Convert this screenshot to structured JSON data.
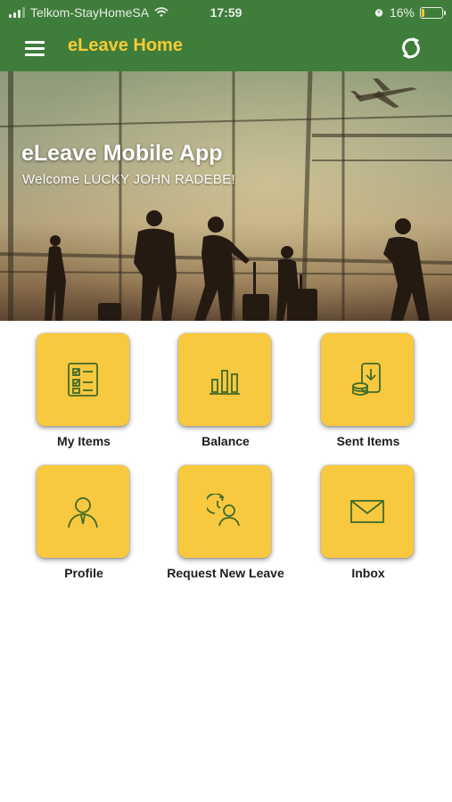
{
  "status_bar": {
    "carrier": "Telkom-StayHomeSA",
    "time": "17:59",
    "battery": "16%",
    "battery_level": 0.16
  },
  "app_bar": {
    "title": "eLeave Home",
    "menu_icon": "hamburger-menu-icon",
    "refresh_icon": "refresh-icon"
  },
  "hero": {
    "title": "eLeave Mobile App",
    "welcome": "Welcome LUCKY JOHN RADEBE!"
  },
  "tiles": [
    {
      "label": "My Items",
      "icon": "checklist-icon"
    },
    {
      "label": "Balance",
      "icon": "bar-chart-icon"
    },
    {
      "label": "Sent Items",
      "icon": "phone-coins-icon"
    },
    {
      "label": "Profile",
      "icon": "person-icon"
    },
    {
      "label": "Request New Leave",
      "icon": "person-clock-icon"
    },
    {
      "label": "Inbox",
      "icon": "envelope-icon"
    }
  ],
  "colors": {
    "appbar": "#3f7d3a",
    "title": "#f6cb34",
    "tile": "#f8c83e",
    "icon_stroke": "#3f6b2a"
  }
}
